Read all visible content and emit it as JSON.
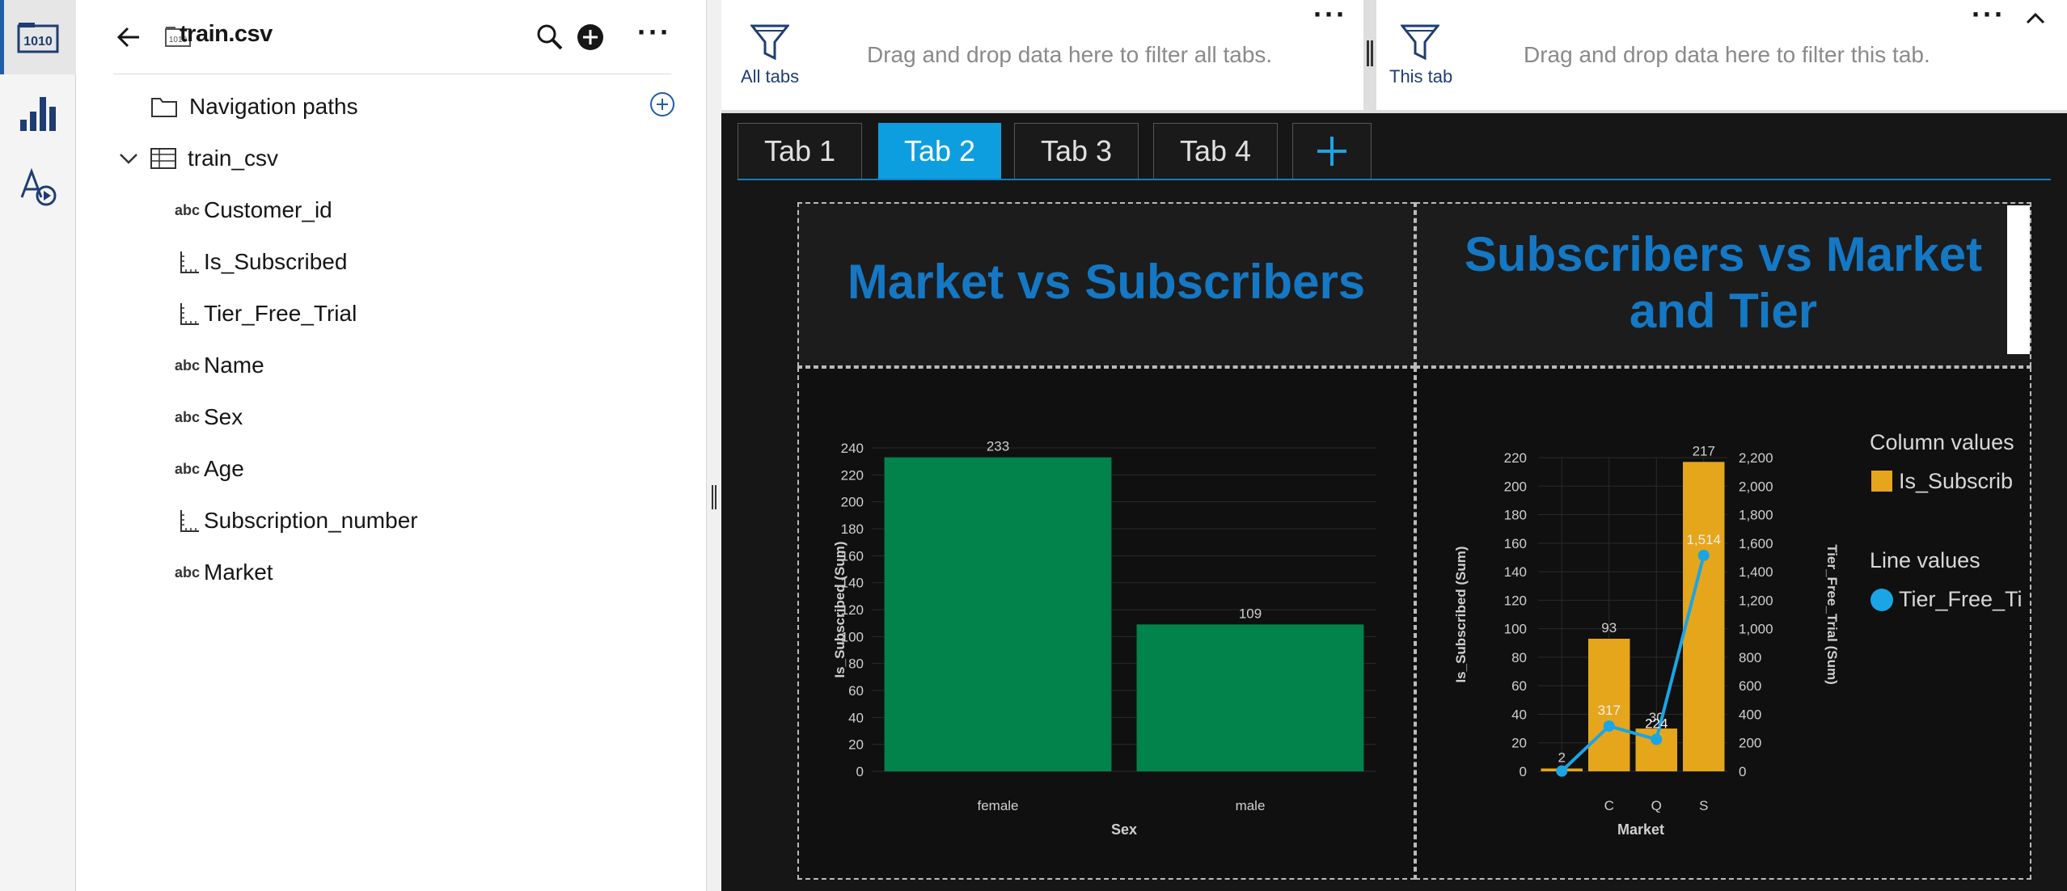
{
  "datasource": {
    "title": "train.csv",
    "navigation_paths": "Navigation paths",
    "table_name": "train_csv",
    "fields": [
      {
        "type": "abc",
        "name": "Customer_id"
      },
      {
        "type": "measure",
        "name": "Is_Subscribed"
      },
      {
        "type": "measure",
        "name": "Tier_Free_Trial"
      },
      {
        "type": "abc",
        "name": "Name"
      },
      {
        "type": "abc",
        "name": "Sex"
      },
      {
        "type": "abc",
        "name": "Age"
      },
      {
        "type": "measure",
        "name": "Subscription_number"
      },
      {
        "type": "abc",
        "name": "Market"
      }
    ]
  },
  "filters": {
    "all_tabs_label": "All tabs",
    "all_tabs_hint": "Drag and drop data here to filter all tabs.",
    "this_tab_label": "This tab",
    "this_tab_hint": "Drag and drop data here to filter this tab."
  },
  "tabs": [
    {
      "label": "Tab 1",
      "active": false
    },
    {
      "label": "Tab 2",
      "active": true
    },
    {
      "label": "Tab 3",
      "active": false
    },
    {
      "label": "Tab 4",
      "active": false
    }
  ],
  "widgets": {
    "title1": "Market vs Subscribers",
    "title2_line1": "Subscribers vs Market",
    "title2_line2": "and Tier"
  },
  "colors": {
    "green_bar": "#02834b",
    "orange_bar": "#e5a61b",
    "line": "#1aa5e6",
    "accent": "#1478c4"
  },
  "chart_data": [
    {
      "type": "bar",
      "categories": [
        "female",
        "male"
      ],
      "values": [
        233,
        109
      ],
      "xlabel": "Sex",
      "ylabel": "Is_Subscribed (Sum)",
      "ylim": [
        0,
        240
      ],
      "yticks": [
        "0",
        "20",
        "40",
        "60",
        "80",
        "100",
        "120",
        "140",
        "160",
        "180",
        "200",
        "220",
        "240"
      ],
      "data_labels": [
        "233",
        "109"
      ]
    },
    {
      "type": "bar",
      "categories": [
        "",
        "C",
        "Q",
        "S"
      ],
      "series": [
        {
          "name": "Is_Subscribed",
          "kind": "bar",
          "axis": "left",
          "values": [
            2,
            93,
            30,
            217
          ],
          "labels": [
            "2",
            "93",
            "30",
            "217"
          ]
        },
        {
          "name": "Tier_Free_Trial",
          "kind": "line",
          "axis": "right",
          "values": [
            2,
            317,
            224,
            1514
          ],
          "labels": [
            "",
            "317",
            "224",
            "1,514"
          ]
        }
      ],
      "xlabel": "Market",
      "ylabel": "Is_Subscribed (Sum)",
      "ylabel_right": "Tier_Free_Trial (Sum)",
      "ylim": [
        0,
        220
      ],
      "ylim_right": [
        0,
        2200
      ],
      "yticks": [
        "0",
        "20",
        "40",
        "60",
        "80",
        "100",
        "120",
        "140",
        "160",
        "180",
        "200",
        "220"
      ],
      "yticks_right": [
        "0",
        "200",
        "400",
        "600",
        "800",
        "1,000",
        "1,200",
        "1,400",
        "1,600",
        "1,800",
        "2,000",
        "2,200"
      ],
      "legend": {
        "column_title": "Column values",
        "column_item": "Is_Subscrib",
        "line_title": "Line values",
        "line_item": "Tier_Free_Ti"
      }
    }
  ]
}
